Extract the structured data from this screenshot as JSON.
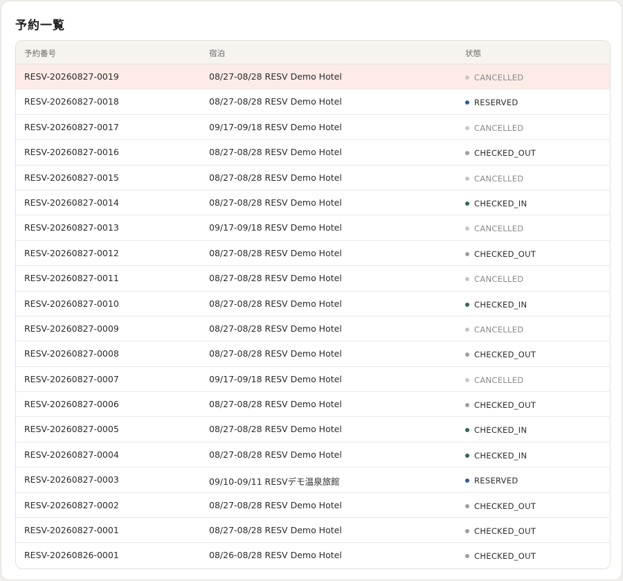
{
  "page_title": "予約一覧",
  "table": {
    "headers": [
      "予約番号",
      "宿泊",
      "状態"
    ],
    "rows": [
      {
        "id": "RESV-20260827-0019",
        "stay": "08/27-08/28 RESV Demo Hotel",
        "status": "CANCELLED",
        "highlighted": true
      },
      {
        "id": "RESV-20260827-0018",
        "stay": "08/27-08/28 RESV Demo Hotel",
        "status": "RESERVED"
      },
      {
        "id": "RESV-20260827-0017",
        "stay": "09/17-09/18 RESV Demo Hotel",
        "status": "CANCELLED"
      },
      {
        "id": "RESV-20260827-0016",
        "stay": "08/27-08/28 RESV Demo Hotel",
        "status": "CHECKED_OUT"
      },
      {
        "id": "RESV-20260827-0015",
        "stay": "08/27-08/28 RESV Demo Hotel",
        "status": "CANCELLED"
      },
      {
        "id": "RESV-20260827-0014",
        "stay": "08/27-08/28 RESV Demo Hotel",
        "status": "CHECKED_IN"
      },
      {
        "id": "RESV-20260827-0013",
        "stay": "09/17-09/18 RESV Demo Hotel",
        "status": "CANCELLED"
      },
      {
        "id": "RESV-20260827-0012",
        "stay": "08/27-08/28 RESV Demo Hotel",
        "status": "CHECKED_OUT"
      },
      {
        "id": "RESV-20260827-0011",
        "stay": "08/27-08/28 RESV Demo Hotel",
        "status": "CANCELLED"
      },
      {
        "id": "RESV-20260827-0010",
        "stay": "08/27-08/28 RESV Demo Hotel",
        "status": "CHECKED_IN"
      },
      {
        "id": "RESV-20260827-0009",
        "stay": "08/27-08/28 RESV Demo Hotel",
        "status": "CANCELLED"
      },
      {
        "id": "RESV-20260827-0008",
        "stay": "08/27-08/28 RESV Demo Hotel",
        "status": "CHECKED_OUT"
      },
      {
        "id": "RESV-20260827-0007",
        "stay": "09/17-09/18 RESV Demo Hotel",
        "status": "CANCELLED"
      },
      {
        "id": "RESV-20260827-0006",
        "stay": "08/27-08/28 RESV Demo Hotel",
        "status": "CHECKED_OUT"
      },
      {
        "id": "RESV-20260827-0005",
        "stay": "08/27-08/28 RESV Demo Hotel",
        "status": "CHECKED_IN"
      },
      {
        "id": "RESV-20260827-0004",
        "stay": "08/27-08/28 RESV Demo Hotel",
        "status": "CHECKED_IN"
      },
      {
        "id": "RESV-20260827-0003",
        "stay": "09/10-09/11 RESVデモ温泉旅館",
        "status": "RESERVED"
      },
      {
        "id": "RESV-20260827-0002",
        "stay": "08/27-08/28 RESV Demo Hotel",
        "status": "CHECKED_OUT"
      },
      {
        "id": "RESV-20260827-0001",
        "stay": "08/27-08/28 RESV Demo Hotel",
        "status": "CHECKED_OUT"
      },
      {
        "id": "RESV-20260826-0001",
        "stay": "08/26-08/28 RESV Demo Hotel",
        "status": "CHECKED_OUT"
      }
    ]
  },
  "status_colors": {
    "CANCELLED": "#c6c6c6",
    "RESERVED": "#2f5c9a",
    "CHECKED_OUT": "#9e9e9e",
    "CHECKED_IN": "#2f6a4f"
  },
  "highlight_color": "#fdece6"
}
